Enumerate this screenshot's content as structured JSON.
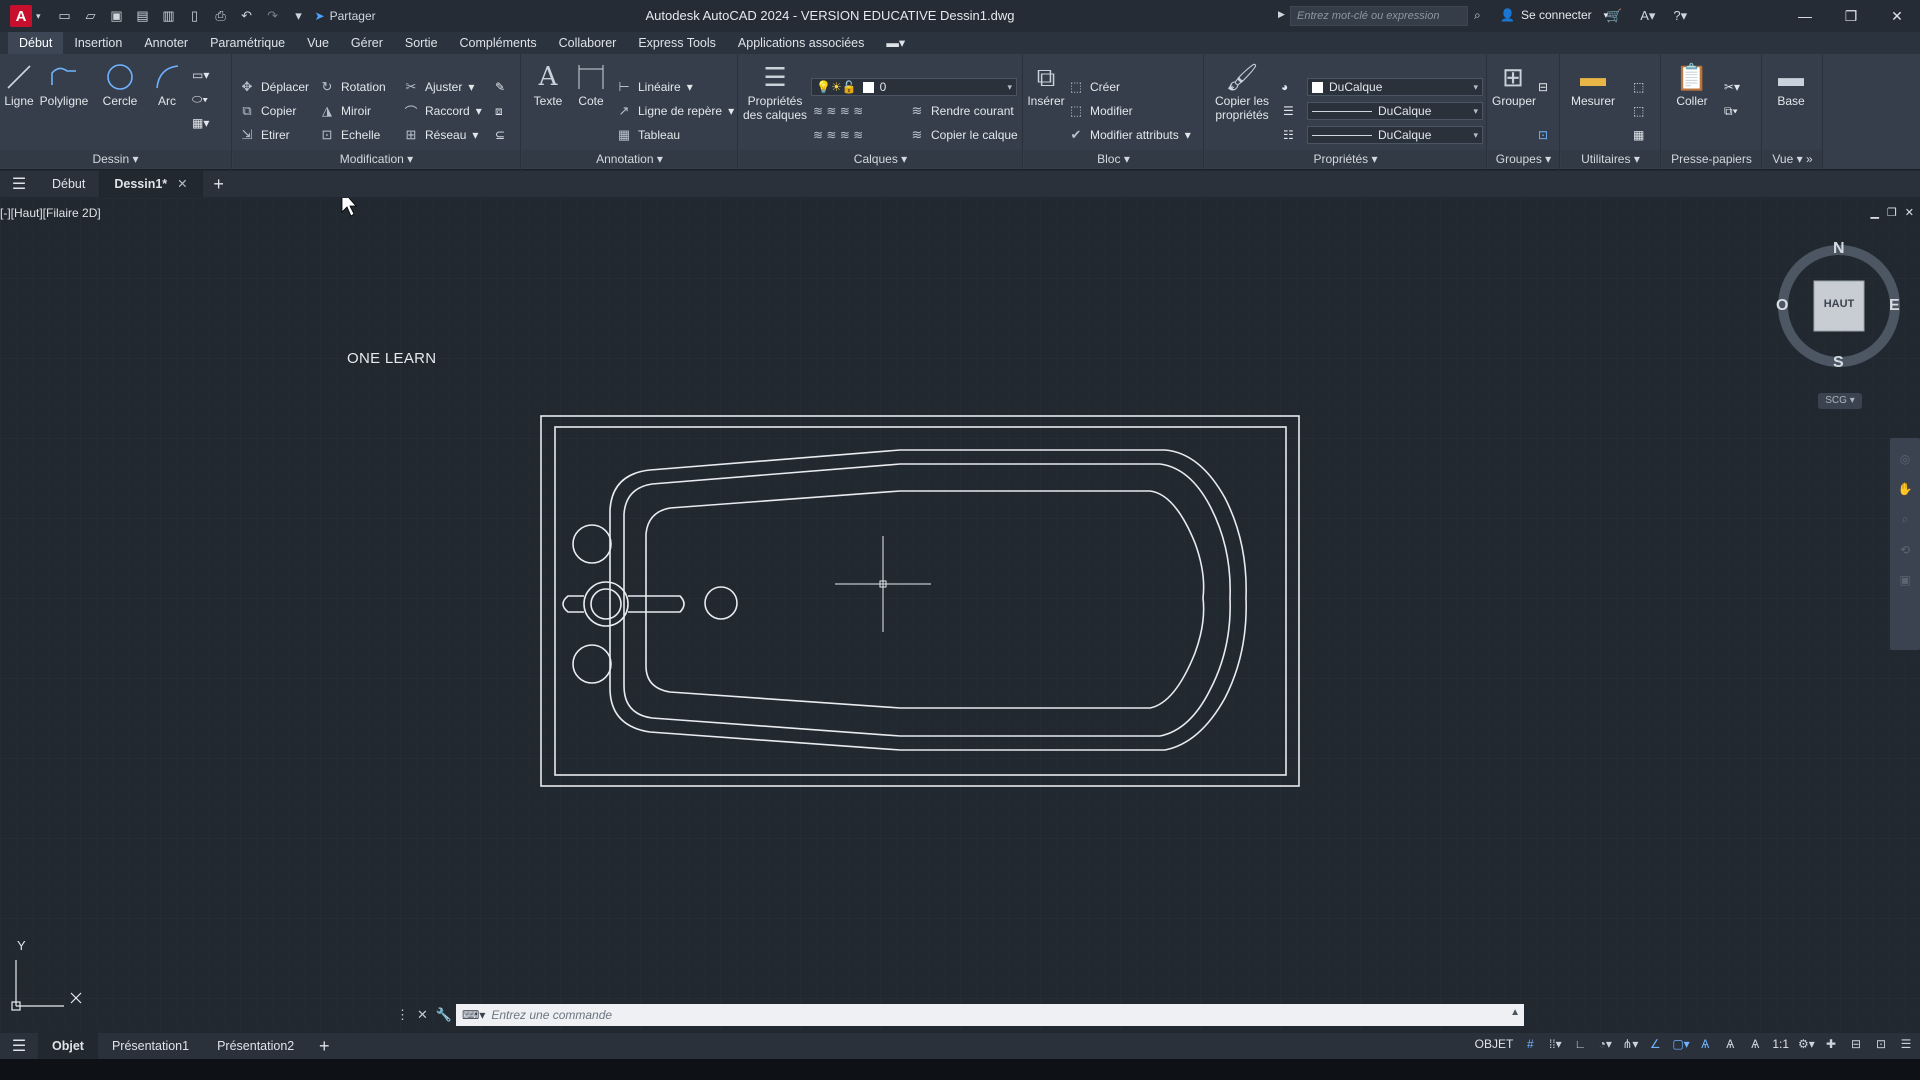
{
  "app": {
    "title": "Autodesk AutoCAD 2024 - VERSION EDUCATIVE    Dessin1.dwg",
    "logo": "A",
    "share_label": "Partager",
    "search_placeholder": "Entrez mot-clé ou expression",
    "login_label": "Se connecter"
  },
  "menu": [
    "Début",
    "Insertion",
    "Annoter",
    "Paramétrique",
    "Vue",
    "Gérer",
    "Sortie",
    "Compléments",
    "Collaborer",
    "Express Tools",
    "Applications associées"
  ],
  "ribbon": {
    "dessin": {
      "title": "Dessin",
      "ligne": "Ligne",
      "polyligne": "Polyligne",
      "cercle": "Cercle",
      "arc": "Arc"
    },
    "modification": {
      "title": "Modification",
      "deplacer": "Déplacer",
      "rotation": "Rotation",
      "ajuster": "Ajuster",
      "copier": "Copier",
      "miroir": "Miroir",
      "raccord": "Raccord",
      "etirer": "Etirer",
      "echelle": "Echelle",
      "reseau": "Réseau"
    },
    "annotation": {
      "title": "Annotation",
      "texte": "Texte",
      "cote": "Cote",
      "lineaire": "Linéaire",
      "ligne_repere": "Ligne de repère",
      "tableau": "Tableau"
    },
    "calques": {
      "title": "Calques",
      "proprietes": "Propriétés des calques",
      "layer_value": "0",
      "rendre_courant": "Rendre courant",
      "copier_calque": "Copier le calque"
    },
    "bloc": {
      "title": "Bloc",
      "inserer": "Insérer",
      "creer": "Créer",
      "modifier": "Modifier",
      "modifier_attributs": "Modifier attributs"
    },
    "proprietes": {
      "title": "Propriétés",
      "copier_proprietes": "Copier les propriétés",
      "color": "DuCalque",
      "linetype": "DuCalque",
      "lineweight": "DuCalque"
    },
    "groupes": {
      "title": "Groupes",
      "grouper": "Grouper"
    },
    "utilitaires": {
      "title": "Utilitaires",
      "mesurer": "Mesurer"
    },
    "presse_papiers": {
      "title": "Presse-papiers",
      "coller": "Coller"
    },
    "vue": {
      "title": "Vue",
      "base": "Base"
    }
  },
  "tabs": {
    "debut": "Début",
    "dessin1": "Dessin1*"
  },
  "viewport": {
    "label": "[-][Haut][Filaire 2D]",
    "annotation_text": "ONE LEARN",
    "viewcube": {
      "n": "N",
      "s": "S",
      "e": "E",
      "o": "O",
      "face": "HAUT",
      "wcs": "SCG"
    },
    "ucs": {
      "x": "X",
      "y": "Y"
    }
  },
  "command": {
    "placeholder": "Entrez une commande"
  },
  "layout_tabs": [
    "Objet",
    "Présentation1",
    "Présentation2"
  ],
  "status": {
    "objet_label": "OBJET",
    "scale": "1:1"
  }
}
